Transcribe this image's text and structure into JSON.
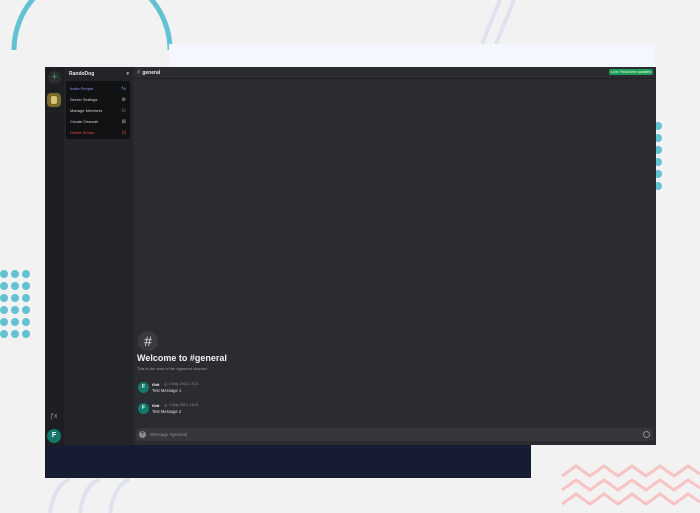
{
  "server": {
    "name": "RandoDog",
    "chevron_icon": "chevron-down-icon",
    "menu": [
      {
        "label": "Invite People",
        "icon": "invite-icon",
        "color": "#8e9bf5"
      },
      {
        "label": "Server Settings",
        "icon": "gear-icon"
      },
      {
        "label": "Manage Members",
        "icon": "members-icon"
      },
      {
        "label": "Create Channel",
        "icon": "plus-square-icon"
      },
      {
        "label": "Delete Server",
        "icon": "trash-icon",
        "color": "#f04747"
      }
    ]
  },
  "channel": {
    "name": "general",
    "live_label": "Live: Real-time updates"
  },
  "welcome": {
    "title": "Welcome to #general",
    "subtitle": "This is the start of the #general channel."
  },
  "messages": [
    {
      "avatar": "F",
      "author": "f2dt",
      "time": "3 May 2024, 19:21",
      "text": "Test Message 1"
    },
    {
      "avatar": "F",
      "author": "f2dt",
      "time": "3 May 2024, 19:21",
      "text": "Test Message 2"
    }
  ],
  "composer": {
    "placeholder": "Message #general"
  },
  "user": {
    "avatar": "F"
  },
  "colors": {
    "accent_green": "#1f9c58",
    "avatar_teal": "#15786c",
    "danger": "#f04747",
    "invite": "#8e9bf5"
  }
}
